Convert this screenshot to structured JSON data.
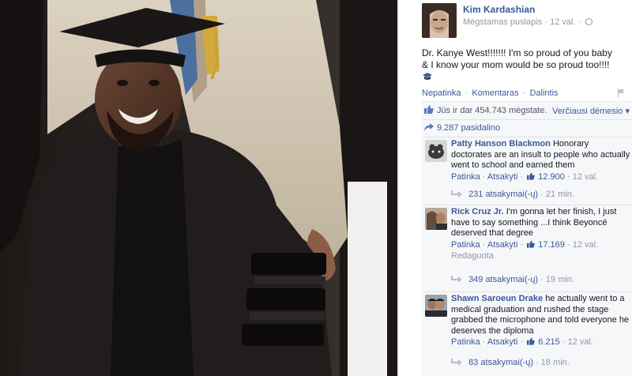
{
  "post": {
    "author": "Kim Kardashian",
    "page_type": "Mėgstamas puslapis",
    "time": "12 val.",
    "text": "Dr. Kanye West!!!!!!! I'm so proud of you baby & I know your mom would be so proud too!!!!",
    "actions": {
      "unlike": "Nepatinka",
      "comment": "Komentaras",
      "share": "Dalintis",
      "separator": "·"
    }
  },
  "likes": {
    "text": "Jūs ir dar 454.743 mėgstate.",
    "sort_label": "Verčiausi dėmesio ▾"
  },
  "shares": {
    "text": "9.287 pasidalino"
  },
  "comments": [
    {
      "name": "Patty Hanson Blackmon",
      "text": "Honorary doctorates are an insult to people who actually went to school and earned them",
      "like_label": "Patinka",
      "reply_label": "Atsakyti",
      "likes": "12.900",
      "time": "12 val.",
      "edited": "",
      "replies": "231 atsakymai(-ų)",
      "replies_time": "21 min."
    },
    {
      "name": "Rick Cruz Jr.",
      "text": "I'm gonna let her finish, I just have to say something ...I think Beyoncé deserved that degree",
      "like_label": "Patinka",
      "reply_label": "Atsakyti",
      "likes": "17.169",
      "time": "12 val.",
      "edited": "Redaguota",
      "replies": "349 atsakymai(-ų)",
      "replies_time": "19 min."
    },
    {
      "name": "Shawn Saroeun Drake",
      "text": "he actually went to a medical graduation and rushed the stage grabbed the microphone and told everyone he deserves the diploma",
      "like_label": "Patinka",
      "reply_label": "Atsakyti",
      "likes": "6.215",
      "time": "12 val.",
      "edited": "",
      "replies": "83 atsakymai(-ų)",
      "replies_time": "18 min."
    }
  ],
  "icons": {
    "globe": "globe-icon",
    "flag": "flag-icon",
    "thumb": "thumbs-up-icon",
    "share": "share-icon",
    "reply": "reply-arrow-icon"
  },
  "colors": {
    "link": "#3b5998",
    "meta": "#9197a3",
    "panel_bg": "#f6f7f9"
  }
}
